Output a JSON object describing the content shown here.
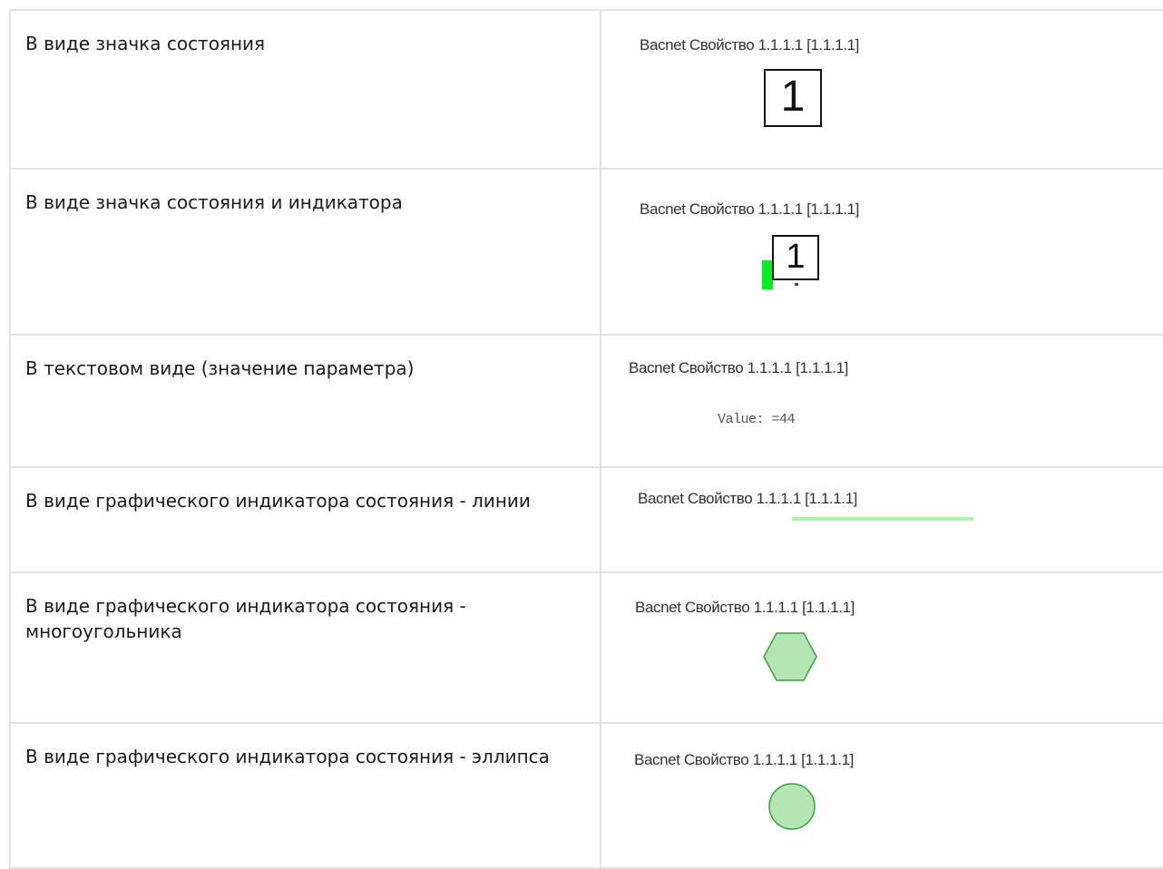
{
  "rows": [
    {
      "description": "В виде значка состояния",
      "caption": "Bacnet Свойство 1.1.1.1 [1.1.1.1]",
      "icon_value": "1"
    },
    {
      "description": "В виде значка состояния и индикатора",
      "caption": "Bacnet Свойство 1.1.1.1 [1.1.1.1]",
      "icon_value": "1",
      "indicator_color": "#00ee22"
    },
    {
      "description": "В текстовом виде (значение параметра)",
      "caption": "Bacnet Свойство 1.1.1.1 [1.1.1.1]",
      "value_text": "Value: =44"
    },
    {
      "description": "В виде графического индикатора состояния - линии",
      "caption": "Bacnet Свойство 1.1.1.1 [1.1.1.1]",
      "line_color": "#aaf2aa"
    },
    {
      "description": "В виде графического индикатора состояния - многоугольника",
      "caption": "Bacnet Свойство 1.1.1.1 [1.1.1.1]",
      "shape_fill": "#b3e6b3",
      "shape_stroke": "#3fa03f"
    },
    {
      "description": "В виде графического индикатора состояния - эллипса",
      "caption": "Bacnet Свойство 1.1.1.1 [1.1.1.1]",
      "shape_fill": "#b3e6b3",
      "shape_stroke": "#3fa03f"
    }
  ]
}
